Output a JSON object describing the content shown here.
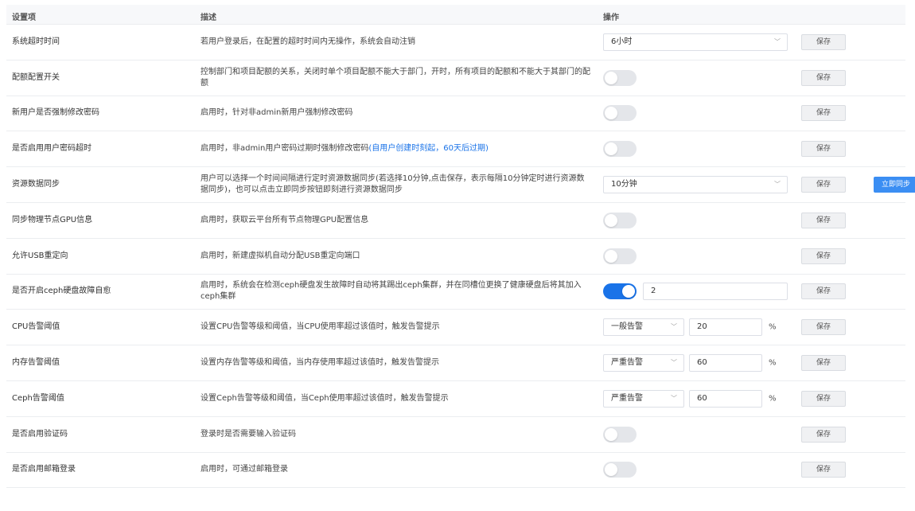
{
  "header": {
    "col_item": "设置项",
    "col_desc": "描述",
    "col_op": "操作"
  },
  "save_label": "保存",
  "sync_now_label": "立即同步",
  "rows": [
    {
      "name": "系统超时时间",
      "desc": "若用户登录后，在配置的超时时间内无操作，系统会自动注销",
      "control": "select",
      "value": "6小时"
    },
    {
      "name": "配额配置开关",
      "desc": "控制部门和项目配额的关系，关闭时单个项目配额不能大于部门，开时，所有项目的配额和不能大于其部门的配额",
      "control": "toggle",
      "on": false
    },
    {
      "name": "新用户是否强制修改密码",
      "desc": "启用时，针对非admin新用户强制修改密码",
      "control": "toggle",
      "on": false
    },
    {
      "name": "是否启用用户密码超时",
      "desc": "启用时，非admin用户密码过期时强制修改密码",
      "desc_link": "(自用户创建时刻起，60天后过期)",
      "control": "toggle",
      "on": false
    },
    {
      "name": "资源数据同步",
      "desc": "用户可以选择一个时间间隔进行定时资源数据同步(若选择10分钟,点击保存，表示每隔10分钟定时进行资源数据同步)，也可以点击立即同步按钮即刻进行资源数据同步",
      "control": "select",
      "value": "10分钟"
    },
    {
      "name": "同步物理节点GPU信息",
      "desc": "启用时，获取云平台所有节点物理GPU配置信息",
      "control": "toggle",
      "on": false
    },
    {
      "name": "允许USB重定向",
      "desc": "启用时，新建虚拟机自动分配USB重定向端口",
      "control": "toggle",
      "on": false
    },
    {
      "name": "是否开启ceph硬盘故障自愈",
      "desc": "启用时，系统会在检测ceph硬盘发生故障时自动将其踢出ceph集群，并在同槽位更换了健康硬盘后将其加入ceph集群",
      "control": "toggle_input",
      "on": true,
      "value": "2"
    },
    {
      "name": "CPU告警阈值",
      "desc": "设置CPU告警等级和阈值，当CPU使用率超过该值时，触发告警提示",
      "control": "level_threshold",
      "level": "一般告警",
      "value": "20",
      "unit": "%"
    },
    {
      "name": "内存告警阈值",
      "desc": "设置内存告警等级和阈值，当内存使用率超过该值时，触发告警提示",
      "control": "level_threshold",
      "level": "严重告警",
      "value": "60",
      "unit": "%"
    },
    {
      "name": "Ceph告警阈值",
      "desc": "设置Ceph告警等级和阈值，当Ceph使用率超过该值时，触发告警提示",
      "control": "level_threshold",
      "level": "严重告警",
      "value": "60",
      "unit": "%"
    },
    {
      "name": "是否启用验证码",
      "desc": "登录时是否需要输入验证码",
      "control": "toggle",
      "on": false
    },
    {
      "name": "是否启用邮箱登录",
      "desc": "启用时，可通过邮箱登录",
      "control": "toggle",
      "on": false
    }
  ]
}
